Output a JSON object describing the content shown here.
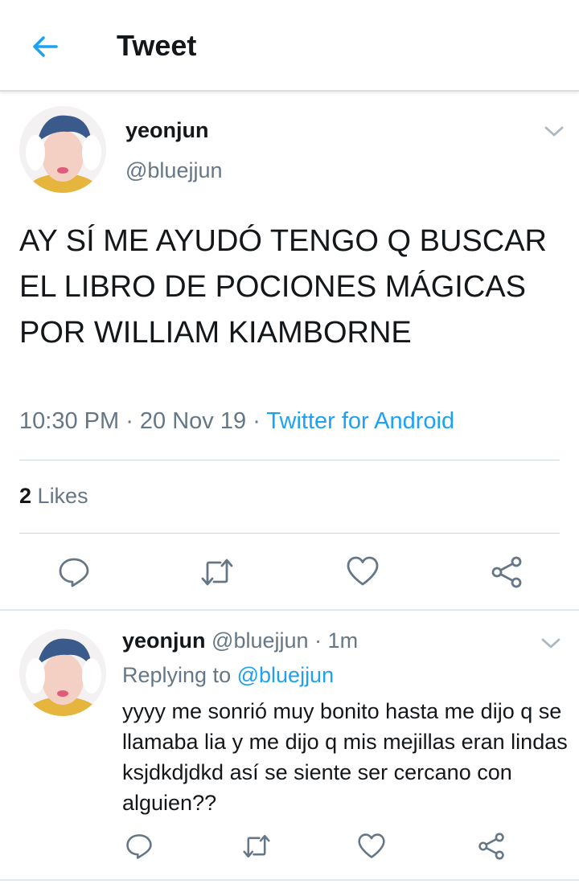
{
  "header": {
    "title": "Tweet",
    "back_icon": "arrow-left-icon"
  },
  "colors": {
    "accent": "#1da1f2",
    "secondary_text": "#657786",
    "primary_text": "#14171a"
  },
  "tweet": {
    "author_name": "yeonjun",
    "author_handle": "@bluejjun",
    "text": "AY SÍ ME AYUDÓ TENGO Q BUSCAR EL LIBRO DE POCIONES MÁGICAS POR WILLIAM KIAMBORNE",
    "time": "10:30 PM",
    "date": "20 Nov 19",
    "source": "Twitter for Android",
    "likes_count": "2",
    "likes_label": "Likes"
  },
  "reply": {
    "author_name": "yeonjun",
    "author_handle": "@bluejjun",
    "age": "1m",
    "replying_prefix": "Replying to",
    "replying_to": "@bluejjun",
    "text": "yyyy me sonrió muy bonito hasta me dijo q se llamaba lia y me dijo q mis mejillas eran lindas ksjdkdjdkd así se siente ser cercano con alguien??"
  },
  "actions": [
    "reply-icon",
    "retweet-icon",
    "like-icon",
    "share-icon"
  ]
}
